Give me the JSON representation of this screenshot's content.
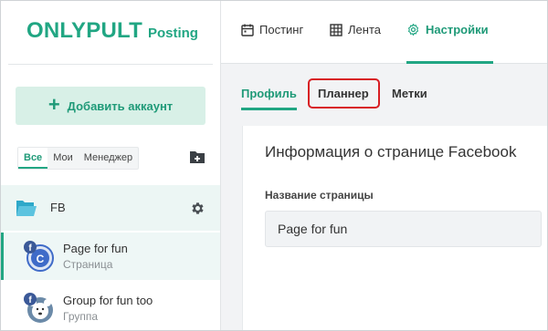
{
  "brand": {
    "name": "ONLYPULT",
    "product": "Posting"
  },
  "sidebar": {
    "add_account_label": "Добавить аккаунт",
    "filters": [
      {
        "label": "Все",
        "active": true
      },
      {
        "label": "Мои",
        "active": false
      },
      {
        "label": "Менеджер",
        "active": false
      }
    ],
    "group": {
      "label": "FB"
    },
    "pages": [
      {
        "name": "Page for fun",
        "type": "Страница",
        "avatar_letter": "C",
        "network_badge": "f",
        "selected": true
      },
      {
        "name": "Group for fun too",
        "type": "Группа",
        "avatar_letter": "",
        "network_badge": "f",
        "selected": false
      }
    ]
  },
  "topnav": {
    "items": [
      {
        "label": "Постинг",
        "icon": "calendar-icon",
        "active": false
      },
      {
        "label": "Лента",
        "icon": "grid-icon",
        "active": false
      },
      {
        "label": "Настройки",
        "icon": "gear-icon",
        "active": true
      }
    ]
  },
  "subtabs": [
    {
      "label": "Профиль",
      "active": true
    },
    {
      "label": "Планнер",
      "active": false,
      "highlighted": true
    },
    {
      "label": "Метки",
      "active": false
    }
  ],
  "card": {
    "title": "Информация о странице Facebook",
    "field_label": "Название страницы",
    "field_value": "Page for fun"
  },
  "colors": {
    "accent": "#21a683",
    "accent_light": "#d8f0e7",
    "highlight": "#d81e24",
    "facebook": "#3b5998"
  }
}
